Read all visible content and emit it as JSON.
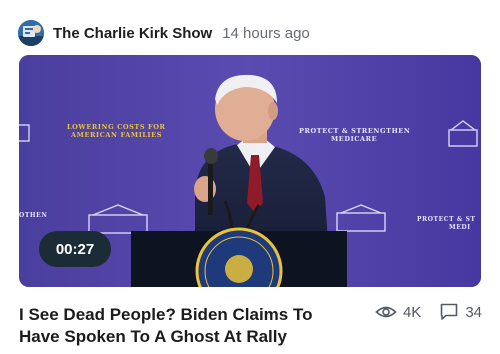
{
  "post": {
    "channel_name": "The Charlie Kirk Show",
    "timestamp": "14 hours ago",
    "video": {
      "duration": "00:27",
      "backdrop_text": {
        "left_banner": "LOWERING COSTS FOR AMERICAN FAMILIES",
        "right_banner": "PROTECT & STRENGTHEN MEDICARE",
        "lower_left": "OTHEN",
        "lower_right": "PROTECT & ST MEDI"
      }
    },
    "title": "I See Dead People? Biden Claims To Have Spoken To A Ghost At Rally",
    "views": "4K",
    "comments": "34"
  },
  "colors": {
    "backdrop": "#4a3fa0",
    "duration_pill": "#1c2c36",
    "accent_gold": "#e9c33a"
  },
  "icons": {
    "avatar": "channel-avatar-icon",
    "views": "eye-icon",
    "comments": "speech-bubble-icon"
  }
}
